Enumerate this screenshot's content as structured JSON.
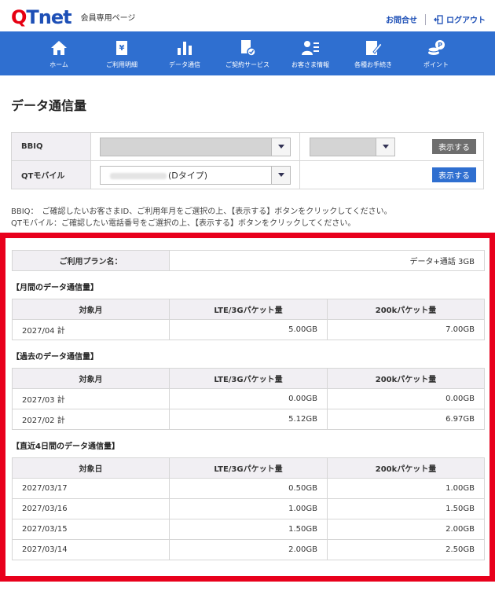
{
  "header": {
    "logo_q": "Q",
    "logo_rest": "Tnet",
    "subtitle": "会員専用ページ",
    "contact": "お問合せ",
    "logout": "ログアウト"
  },
  "nav": [
    {
      "label": "ホーム",
      "icon": "home-icon"
    },
    {
      "label": "ご利用明細",
      "icon": "yen-document-icon"
    },
    {
      "label": "データ通信",
      "icon": "bar-chart-icon"
    },
    {
      "label": "ご契約サービス",
      "icon": "contract-check-icon"
    },
    {
      "label": "お客さま情報",
      "icon": "user-info-icon"
    },
    {
      "label": "各種お手続き",
      "icon": "form-edit-icon"
    },
    {
      "label": "ポイント",
      "icon": "coins-point-icon"
    }
  ],
  "page_title": "データ通信量",
  "selectors": {
    "bbiq_label": "BBIQ",
    "bbiq_button": "表示する",
    "mobile_label": "QTモバイル",
    "mobile_value": "(Dタイプ)",
    "mobile_button": "表示する"
  },
  "notes": {
    "line1": "BBIQ：　ご確認したいお客さまID、ご利用年月をご選択の上、【表示する】ボタンをクリックしてください。",
    "line2": "QTモバイル：ご確認したい電話番号をご選択の上、【表示する】ボタンをクリックしてください。"
  },
  "plan": {
    "label": "ご利用プラン名：",
    "value": "データ+通話 3GB"
  },
  "monthly": {
    "title": "【月間のデータ通信量】",
    "headers": [
      "対象月",
      "LTE/3Gパケット量",
      "200kパケット量"
    ],
    "rows": [
      [
        "2027/04 計",
        "5.00GB",
        "7.00GB"
      ]
    ]
  },
  "past": {
    "title": "【過去のデータ通信量】",
    "headers": [
      "対象月",
      "LTE/3Gパケット量",
      "200kパケット量"
    ],
    "rows": [
      [
        "2027/03 計",
        "0.00GB",
        "0.00GB"
      ],
      [
        "2027/02 計",
        "5.12GB",
        "6.97GB"
      ]
    ]
  },
  "recent": {
    "title": "【直近4日間のデータ通信量】",
    "headers": [
      "対象日",
      "LTE/3Gパケット量",
      "200kパケット量"
    ],
    "rows": [
      [
        "2027/03/17",
        "0.50GB",
        "1.00GB"
      ],
      [
        "2027/03/16",
        "1.00GB",
        "1.50GB"
      ],
      [
        "2027/03/15",
        "1.50GB",
        "2.00GB"
      ],
      [
        "2027/03/14",
        "2.00GB",
        "2.50GB"
      ]
    ]
  },
  "colors": {
    "brand_blue": "#1d4fb6",
    "nav_blue": "#2f6fd0",
    "logo_red": "#e60012",
    "highlight_red": "#e8001c"
  }
}
